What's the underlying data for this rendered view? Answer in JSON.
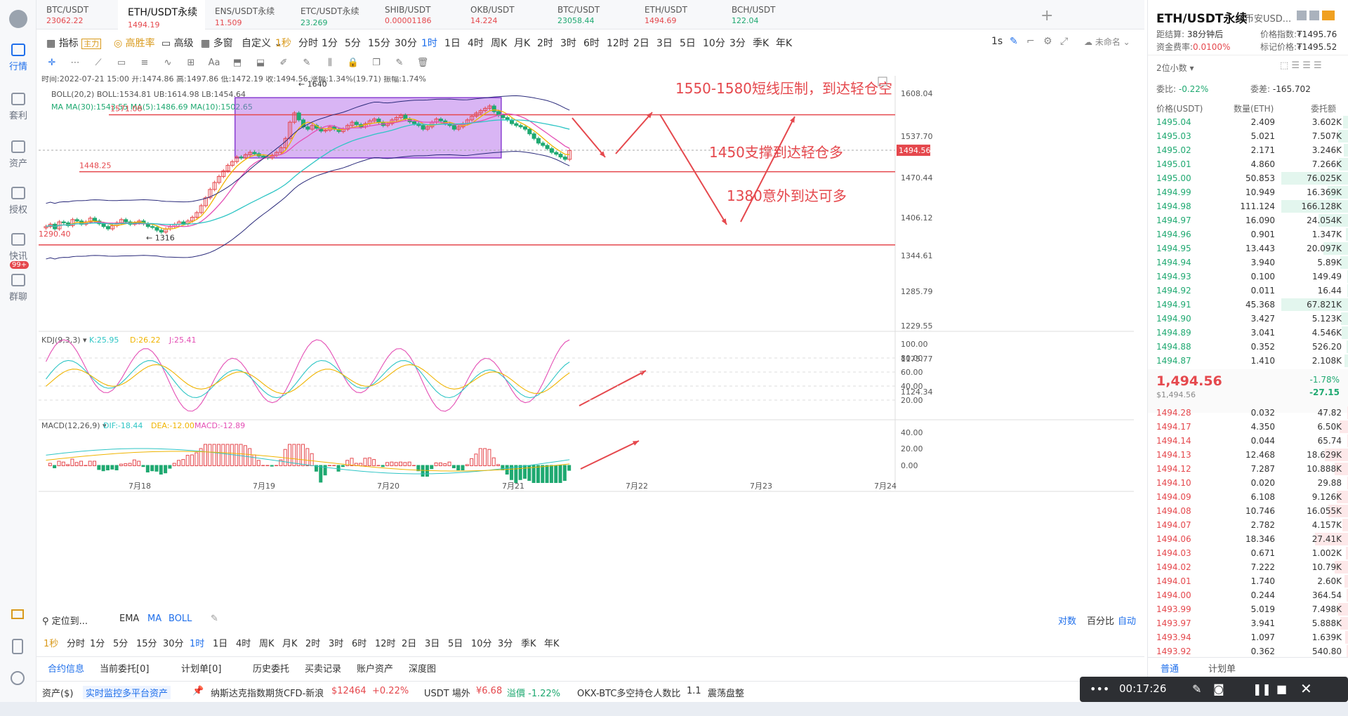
{
  "sidebar": {
    "items": [
      {
        "label": "行情",
        "icon": "chart-b-icon",
        "active": true
      },
      {
        "label": "套利",
        "icon": "yield-icon"
      },
      {
        "label": "资产",
        "icon": "wallet-icon"
      },
      {
        "label": "授权",
        "icon": "key-icon"
      },
      {
        "label": "快讯",
        "icon": "news-icon"
      },
      {
        "label": "群聊",
        "icon": "chat-icon",
        "badge": "99+"
      }
    ]
  },
  "tabs": [
    {
      "name": "BTC/USDT",
      "price": "23062.22",
      "color": "#e5484d"
    },
    {
      "name": "ETH/USDT永续",
      "price": "1494.19",
      "color": "#e5484d",
      "active": true
    },
    {
      "name": "ENS/USDT永续",
      "price": "11.509",
      "color": "#e5484d"
    },
    {
      "name": "ETC/USDT永续",
      "price": "23.269",
      "color": "#1fa971"
    },
    {
      "name": "SHIB/USDT",
      "price": "0.00001186",
      "color": "#e5484d"
    },
    {
      "name": "OKB/USDT",
      "price": "14.224",
      "color": "#e5484d"
    },
    {
      "name": "BTC/USDT",
      "price": "23058.44",
      "color": "#1fa971"
    },
    {
      "name": "ETH/USDT",
      "price": "1494.69",
      "color": "#e5484d"
    },
    {
      "name": "BCH/USDT",
      "price": "122.04",
      "color": "#1fa971"
    }
  ],
  "toolbar1": {
    "indicator": "指标",
    "main_tag": "主力",
    "high_win": "高胜率",
    "advanced": "高级",
    "multi": "多窗",
    "custom": "自定义",
    "intervals": [
      "1秒",
      "分时",
      "1分",
      "5分",
      "15分",
      "30分",
      "1时",
      "1日",
      "4时",
      "周K",
      "月K",
      "2时",
      "3时",
      "6时",
      "12时",
      "2日",
      "3日",
      "5日",
      "10分",
      "3分",
      "季K",
      "年K"
    ],
    "active_interval": "1时",
    "right": [
      "1s",
      "未命名"
    ]
  },
  "ohlc": {
    "time": "时间:2022-07-21 15:00",
    "open": "开:1474.86",
    "high": "高:1497.86",
    "low": "低:1472.19",
    "close": "收:1494.56",
    "change": "涨幅:1.34%(19.71)",
    "amp": "振幅:1.74%"
  },
  "boll": {
    "label": "BOLL(20,2)",
    "mid": "BOLL:1534.81",
    "ub": "UB:1614.98",
    "lb": "LB:1454.64"
  },
  "ma": {
    "label": "MA",
    "ma30": "MA(30):1543.55",
    "ma5": "MA(5):1486.69",
    "ma10": "MA(10):1502.65"
  },
  "kdj": {
    "label": "KDJ(9,3,3)",
    "k": "K:25.95",
    "d": "D:26.22",
    "j": "J:25.41",
    "ticks": [
      "100.00",
      "80.00",
      "60.00",
      "40.00",
      "20.00"
    ]
  },
  "macd": {
    "label": "MACD(12,26,9)",
    "dif": "DIF:-18.44",
    "dea": "DEA:-12.00",
    "macd": "MACD:-12.89",
    "ticks": [
      "40.00",
      "20.00",
      "0.00"
    ]
  },
  "chart_data": {
    "type": "candlestick",
    "ylim": [
      1110,
      1640
    ],
    "price_ticks": [
      "1608.04",
      "1537.70",
      "1470.44",
      "1406.12",
      "1344.61",
      "1285.79",
      "1229.55",
      "1175.77",
      "1124.34"
    ],
    "dates": [
      "7月18",
      "7月19",
      "7月20",
      "7月21",
      "7月22",
      "7月23",
      "7月24"
    ],
    "current_price": "1494.56",
    "labels": {
      "high": "1640",
      "low": "1316",
      "left_low": "1290.40",
      "line_1571": "1571.08",
      "line_1448": "1448.25"
    },
    "annotations": [
      "1550-1580短线压制，到达轻仓空",
      "1450支撑到达轻仓多",
      "1380意外到达可多"
    ],
    "hlines": [
      1571.08,
      1448.25,
      1290.4
    ],
    "box": {
      "top": 1608,
      "bottom": 1478
    },
    "closes": [
      1330,
      1335,
      1325,
      1340,
      1338,
      1332,
      1345,
      1342,
      1335,
      1340,
      1348,
      1342,
      1336,
      1330,
      1325,
      1332,
      1338,
      1345,
      1340,
      1335,
      1338,
      1342,
      1336,
      1330,
      1328,
      1322,
      1318,
      1325,
      1330,
      1335,
      1340,
      1336,
      1342,
      1350,
      1360,
      1375,
      1392,
      1410,
      1425,
      1438,
      1450,
      1462,
      1470,
      1480,
      1478,
      1485,
      1490,
      1487,
      1482,
      1480,
      1478,
      1484,
      1490,
      1500,
      1520,
      1555,
      1575,
      1560,
      1545,
      1540,
      1548,
      1542,
      1536,
      1538,
      1545,
      1540,
      1535,
      1540,
      1548,
      1555,
      1550,
      1545,
      1552,
      1558,
      1562,
      1555,
      1548,
      1552,
      1560,
      1565,
      1570,
      1562,
      1556,
      1552,
      1548,
      1540,
      1545,
      1555,
      1562,
      1558,
      1552,
      1548,
      1540,
      1545,
      1552,
      1560,
      1568,
      1575,
      1580,
      1585,
      1590,
      1578,
      1570,
      1565,
      1560,
      1552,
      1548,
      1545,
      1540,
      1530,
      1520,
      1510,
      1505,
      1498,
      1490,
      1486,
      1480,
      1475,
      1494
    ]
  },
  "bottom_toolbar": {
    "locate": "定位到...",
    "inds": [
      "EMA",
      "MA",
      "BOLL"
    ],
    "right": [
      "对数",
      "百分比",
      "自动"
    ]
  },
  "bottom_intervals": [
    "1秒",
    "分时",
    "1分",
    "5分",
    "15分",
    "30分",
    "1时",
    "1日",
    "4时",
    "周K",
    "月K",
    "2时",
    "3时",
    "6时",
    "12时",
    "2日",
    "3日",
    "5日",
    "10分",
    "3分",
    "季K",
    "年K"
  ],
  "bottom_tabs": [
    "合约信息",
    "当前委托[0]",
    "计划单[0]",
    "历史委托",
    "买卖记录",
    "账户资产",
    "深度图"
  ],
  "status": {
    "assets": "资产($)",
    "monitor": "实时监控多平台资产",
    "cfd": "纳斯达克指数期货CFD-新浪",
    "cfd_price": "$12464",
    "cfd_change": "+0.22%",
    "usdt": "USDT 場外",
    "usdt_price": "¥6.68",
    "premium": "溢價 -1.22%",
    "okx": "OKX-BTC多空持仓人数比",
    "ratio": "1.1",
    "trend": "震荡盘整"
  },
  "right_panel": {
    "title": "ETH/USDT永续",
    "exchange": "币安USD...",
    "funding_label": "距结算:",
    "funding_time": "38分钟后",
    "price_idx_label": "价格指数:",
    "price_idx": "₮1495.76",
    "rate_label": "资金费率:",
    "rate": "0.0100%",
    "mark_label": "标记价格:",
    "mark": "₮1495.52",
    "decimals": "2位小数",
    "ratio_label": "委比:",
    "ratio": "-0.22%",
    "diff_label": "委差:",
    "diff": "-165.702",
    "headers": [
      "价格(USDT)",
      "数量(ETH)",
      "委托额"
    ],
    "asks": [
      [
        "1495.04",
        "2.409",
        "3.602K"
      ],
      [
        "1495.03",
        "5.021",
        "7.507K"
      ],
      [
        "1495.02",
        "2.171",
        "3.246K"
      ],
      [
        "1495.01",
        "4.860",
        "7.266K"
      ],
      [
        "1495.00",
        "50.853",
        "76.025K"
      ],
      [
        "1494.99",
        "10.949",
        "16.369K"
      ],
      [
        "1494.98",
        "111.124",
        "166.128K"
      ],
      [
        "1494.97",
        "16.090",
        "24.054K"
      ],
      [
        "1494.96",
        "0.901",
        "1.347K"
      ],
      [
        "1494.95",
        "13.443",
        "20.097K"
      ],
      [
        "1494.94",
        "3.940",
        "5.89K"
      ],
      [
        "1494.93",
        "0.100",
        "149.49"
      ],
      [
        "1494.92",
        "0.011",
        "16.44"
      ],
      [
        "1494.91",
        "45.368",
        "67.821K"
      ],
      [
        "1494.90",
        "3.427",
        "5.123K"
      ],
      [
        "1494.89",
        "3.041",
        "4.546K"
      ],
      [
        "1494.88",
        "0.352",
        "526.20"
      ],
      [
        "1494.87",
        "1.410",
        "2.108K"
      ]
    ],
    "last_price": "1,494.56",
    "last_usd": "$1,494.56",
    "change_pct": "-1.78%",
    "change_abs": "-27.15",
    "bids": [
      [
        "1494.28",
        "0.032",
        "47.82"
      ],
      [
        "1494.17",
        "4.350",
        "6.50K"
      ],
      [
        "1494.14",
        "0.044",
        "65.74"
      ],
      [
        "1494.13",
        "12.468",
        "18.629K"
      ],
      [
        "1494.12",
        "7.287",
        "10.888K"
      ],
      [
        "1494.10",
        "0.020",
        "29.88"
      ],
      [
        "1494.09",
        "6.108",
        "9.126K"
      ],
      [
        "1494.08",
        "10.746",
        "16.055K"
      ],
      [
        "1494.07",
        "2.782",
        "4.157K"
      ],
      [
        "1494.06",
        "18.346",
        "27.41K"
      ],
      [
        "1494.03",
        "0.671",
        "1.002K"
      ],
      [
        "1494.02",
        "7.222",
        "10.79K"
      ],
      [
        "1494.01",
        "1.740",
        "2.60K"
      ],
      [
        "1494.00",
        "0.244",
        "364.54"
      ],
      [
        "1493.99",
        "5.019",
        "7.498K"
      ],
      [
        "1493.97",
        "3.941",
        "5.888K"
      ],
      [
        "1493.94",
        "1.097",
        "1.639K"
      ],
      [
        "1493.92",
        "0.362",
        "540.80"
      ]
    ],
    "tabs": [
      "普通",
      "计划单"
    ]
  },
  "recorder": {
    "time": "00:17:26"
  }
}
